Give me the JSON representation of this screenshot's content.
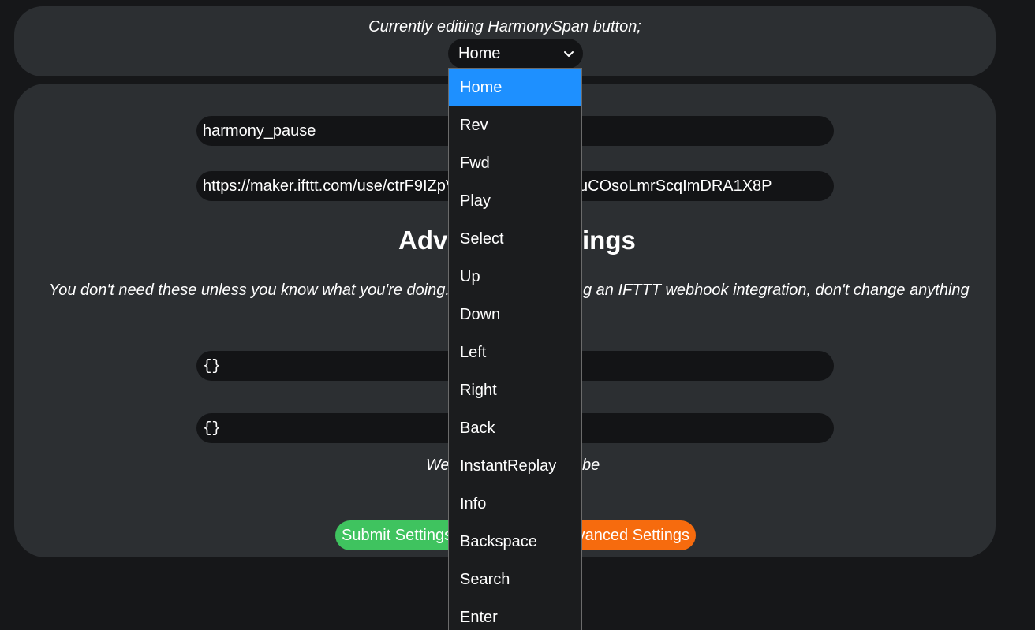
{
  "header": {
    "editing_label": "Currently editing HarmonySpan button;",
    "selected_button": "Home"
  },
  "form": {
    "event_name_value": "harmony_pause",
    "webhook_url_value": "https://maker.ifttt.com/use/ctrF9IZpV",
    "webhook_url_value_tail": "uCOsoLmrScqImDRA1X8P",
    "advanced_heading_left": "Adv",
    "advanced_heading_right": "ings",
    "advanced_note_left": "You don't need these unless you know what you're doing.",
    "advanced_note_right": "g an IFTTT webhook integration, don't change anything",
    "headers_value": "{}",
    "body_value": "{}",
    "bottom_note_left": "We",
    "bottom_note_right": "be",
    "submit_label": "Submit Settings",
    "advanced_label": "vanced Settings"
  },
  "dropdown": {
    "options": [
      "Home",
      "Rev",
      "Fwd",
      "Play",
      "Select",
      "Up",
      "Down",
      "Left",
      "Right",
      "Back",
      "InstantReplay",
      "Info",
      "Backspace",
      "Search",
      "Enter"
    ],
    "selected_index": 0
  },
  "colors": {
    "background": "#161719",
    "panel": "#2c2f32",
    "input": "#131416",
    "submit": "#3fc35f",
    "advanced": "#f66b0e",
    "selected_option": "#1e90ff"
  }
}
